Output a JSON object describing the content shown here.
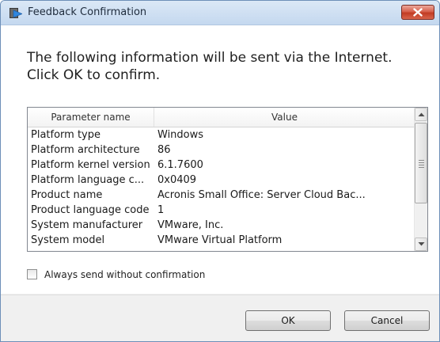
{
  "window": {
    "title": "Feedback Confirmation",
    "close_label": "close"
  },
  "instruction": "The following information will be sent via the Internet. Click OK to confirm.",
  "table": {
    "columns": [
      "Parameter name",
      "Value"
    ],
    "rows": [
      {
        "name": "Platform type",
        "value": "Windows"
      },
      {
        "name": "Platform architecture",
        "value": "86"
      },
      {
        "name": "Platform kernel version",
        "value": "6.1.7600"
      },
      {
        "name": "Platform language c...",
        "value": "0x0409"
      },
      {
        "name": "Product name",
        "value": "Acronis Small Office: Server Cloud Bac..."
      },
      {
        "name": "Product language code",
        "value": "1"
      },
      {
        "name": "System manufacturer",
        "value": "VMware, Inc."
      },
      {
        "name": "System model",
        "value": "VMware Virtual Platform"
      }
    ]
  },
  "checkbox": {
    "label": "Always send without confirmation",
    "checked": false
  },
  "buttons": {
    "ok": "OK",
    "cancel": "Cancel"
  }
}
